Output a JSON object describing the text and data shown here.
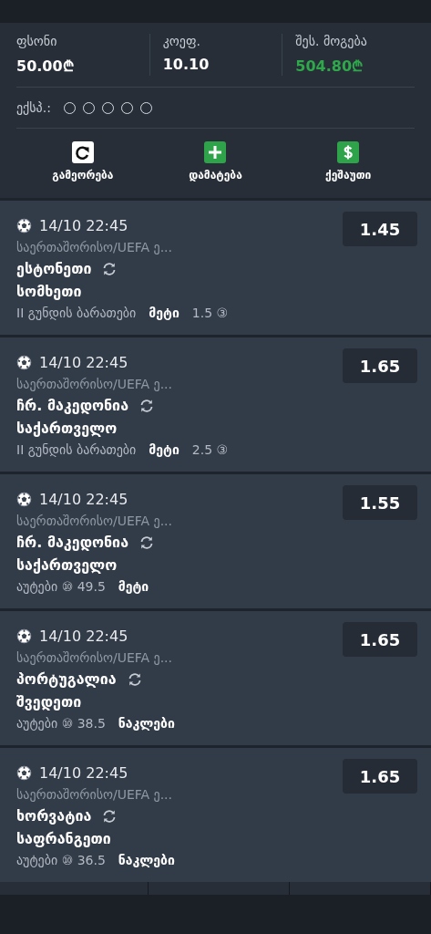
{
  "summary": {
    "stats": [
      {
        "label": "ფსონი",
        "value": "50.00₾",
        "kind": "plain"
      },
      {
        "label": "კოეფ.",
        "value": "10.10",
        "kind": "plain"
      },
      {
        "label": "შეს. მოგება",
        "value": "504.80₾",
        "kind": "win"
      }
    ],
    "express_label": "ექსპ.:",
    "express_slots": [
      {
        "filled": false
      },
      {
        "filled": false
      },
      {
        "filled": false
      },
      {
        "filled": false
      },
      {
        "filled": false
      }
    ],
    "actions": [
      {
        "label": "გამეორება",
        "kind": "repeat"
      },
      {
        "label": "დამატება",
        "kind": "add"
      },
      {
        "label": "ქეშაუთი",
        "kind": "cashout"
      }
    ]
  },
  "bets": [
    {
      "datetime": "14/10 22:45",
      "odds": "1.45",
      "league": "საერთაშორისო/UEFA ე...",
      "home": "ესტონეთი",
      "away": "სომხეთი",
      "market": [
        {
          "text": "II გუნდის ბარათები",
          "pick": false
        },
        {
          "text": "მეტი",
          "pick": true
        },
        {
          "text": "1.5 ③",
          "pick": false
        }
      ]
    },
    {
      "datetime": "14/10 22:45",
      "odds": "1.65",
      "league": "საერთაშორისო/UEFA ე...",
      "home": "ჩრ. მაკედონია",
      "away": "საქართველო",
      "market": [
        {
          "text": "II გუნდის ბარათები",
          "pick": false
        },
        {
          "text": "მეტი",
          "pick": true
        },
        {
          "text": "2.5 ③",
          "pick": false
        }
      ]
    },
    {
      "datetime": "14/10 22:45",
      "odds": "1.55",
      "league": "საერთაშორისო/UEFA ე...",
      "home": "ჩრ. მაკედონია",
      "away": "საქართველო",
      "market": [
        {
          "text": "აუტები ⑩ 49.5",
          "pick": false
        },
        {
          "text": "მეტი",
          "pick": true
        }
      ]
    },
    {
      "datetime": "14/10 22:45",
      "odds": "1.65",
      "league": "საერთაშორისო/UEFA ე...",
      "home": "პორტუგალია",
      "away": "შვედეთი",
      "market": [
        {
          "text": "აუტები ⑩ 38.5",
          "pick": false
        },
        {
          "text": "ნაკლები",
          "pick": true
        }
      ]
    },
    {
      "datetime": "14/10 22:45",
      "odds": "1.65",
      "league": "საერთაშორისო/UEFA ე...",
      "home": "ხორვატია",
      "away": "საფრანგეთი",
      "market": [
        {
          "text": "აუტები ⑩ 36.5",
          "pick": false
        },
        {
          "text": "ნაკლები",
          "pick": true
        }
      ]
    }
  ]
}
